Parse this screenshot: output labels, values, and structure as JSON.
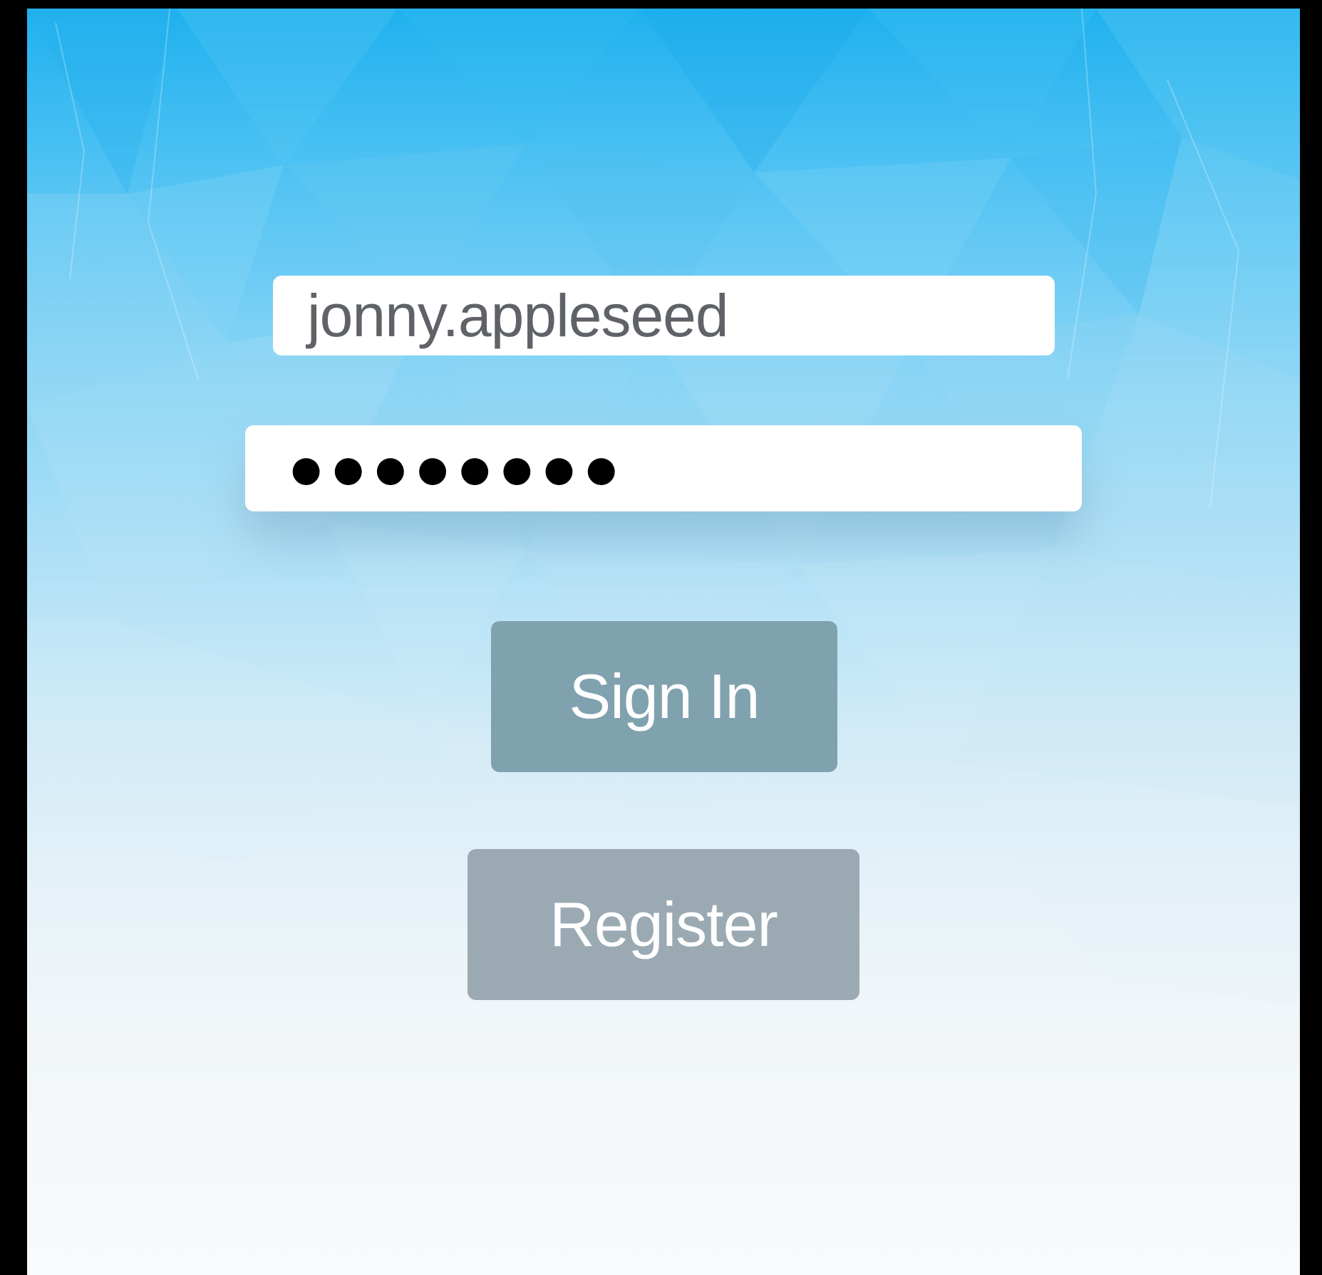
{
  "login": {
    "username_value": "jonny.appleseed",
    "password_masked": "●●●●●●●●",
    "sign_in_label": "Sign In",
    "register_label": "Register"
  },
  "colors": {
    "background_top": "#1fb1ee",
    "background_bottom": "#f8fafb",
    "field_background": "#ffffff",
    "sign_in_button": "#7fa2ae",
    "register_button": "#9aa9b2",
    "button_text": "#ffffff",
    "username_text": "#5f6368",
    "password_text": "#000000"
  }
}
